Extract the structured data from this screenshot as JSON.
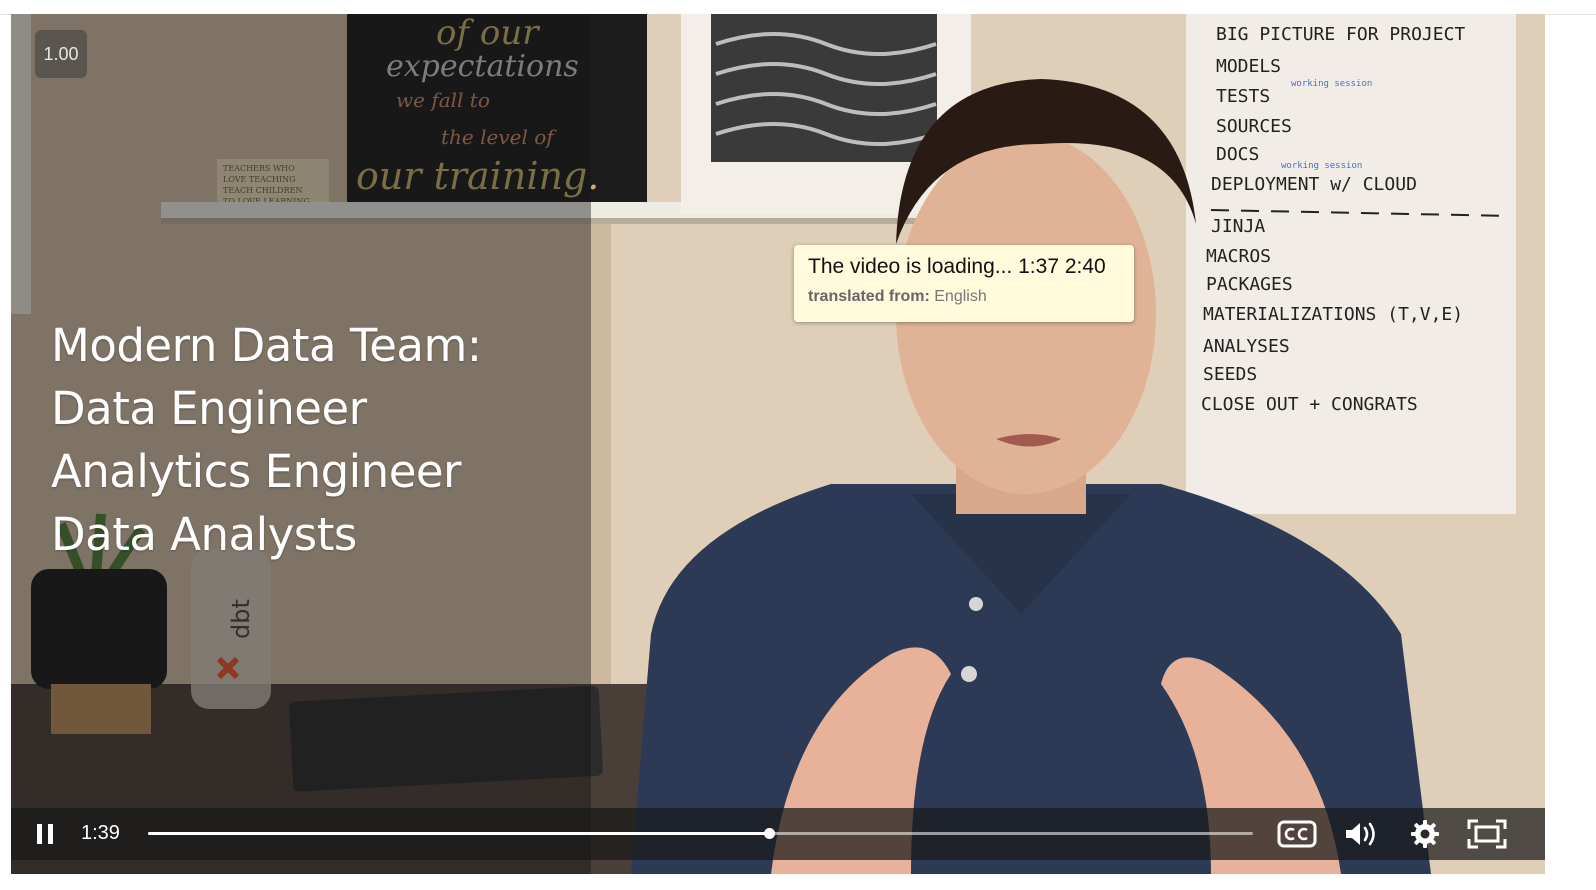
{
  "player": {
    "speed": "1.00",
    "slide_lines": [
      "Modern Data Team:",
      "Data Engineer",
      "Analytics Engineer",
      "Data Analysts"
    ],
    "tooltip": {
      "text": "The video is loading... 1:37 2:40",
      "meta_label": "translated from:",
      "meta_value": "English"
    },
    "controls": {
      "current_time": "1:39",
      "progress": 0.562,
      "icons": [
        "pause-icon",
        "closed-captions-icon",
        "volume-icon",
        "settings-gear-icon",
        "fullscreen-icon"
      ]
    }
  },
  "scene": {
    "poster_lines": [
      "of our",
      "expectations",
      "we fall to",
      "the level of",
      "our training."
    ],
    "small_sign_lines": [
      "TEACHERS WHO",
      "LOVE TEACHING",
      "TEACH CHILDREN",
      "TO LOVE LEARNING"
    ],
    "whiteboard_lines": [
      "BIG PICTURE FOR PROJECT",
      "MODELS",
      "TESTS",
      "SOURCES",
      "DOCS",
      "DEPLOYMENT w/ CLOUD",
      "JINJA",
      "MACROS",
      "PACKAGES",
      "MATERIALIZATIONS (T,V,E)",
      "ANALYSES",
      "SEEDS",
      "CLOSE OUT + CONGRATS"
    ],
    "whiteboard_notes": [
      "working session",
      "working session"
    ],
    "bottle_label": "dbt"
  },
  "colors": {
    "tooltip_bg": "#fffbdc",
    "controls_bg": "#191919",
    "shirt": "#2c3a56"
  }
}
